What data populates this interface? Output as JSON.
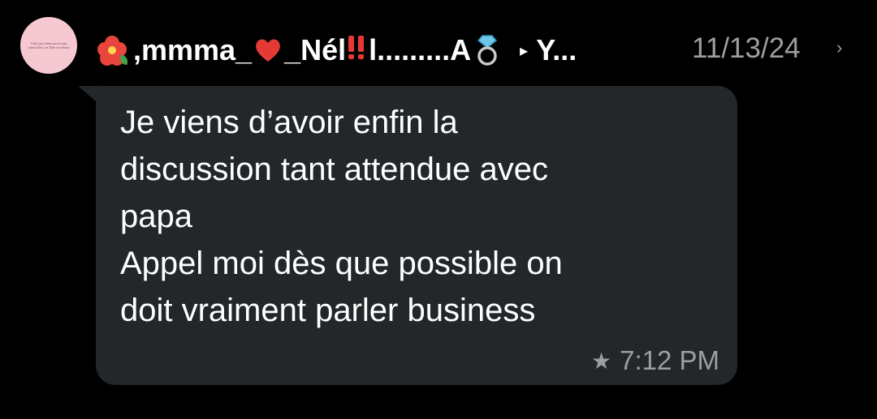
{
  "conversation": {
    "sender_name": ",mmma_",
    "sender_name_2": "_Nél",
    "sender_name_3": "l.........A",
    "recipient_truncated": "Y...",
    "date": "11/13/24",
    "avatar_caption": "Celui qui n'aime pas n'a pas connu Dieu, car Dieu est amour."
  },
  "message": {
    "text": "Je viens d’avoir enfin la\ndiscussion tant attendue avec\npapa\nAppel moi dès que possible on\ndoit vraiment parler business",
    "time": "7:12 PM"
  },
  "icons": {
    "star": "star-icon",
    "chevron": "chevron-right-icon",
    "arrow": "play-arrow-icon"
  },
  "colors": {
    "background": "#000000",
    "bubble": "#23272a",
    "meta": "#9e9e9e",
    "avatar": "#f6c9d2",
    "bang": "#e53935"
  }
}
